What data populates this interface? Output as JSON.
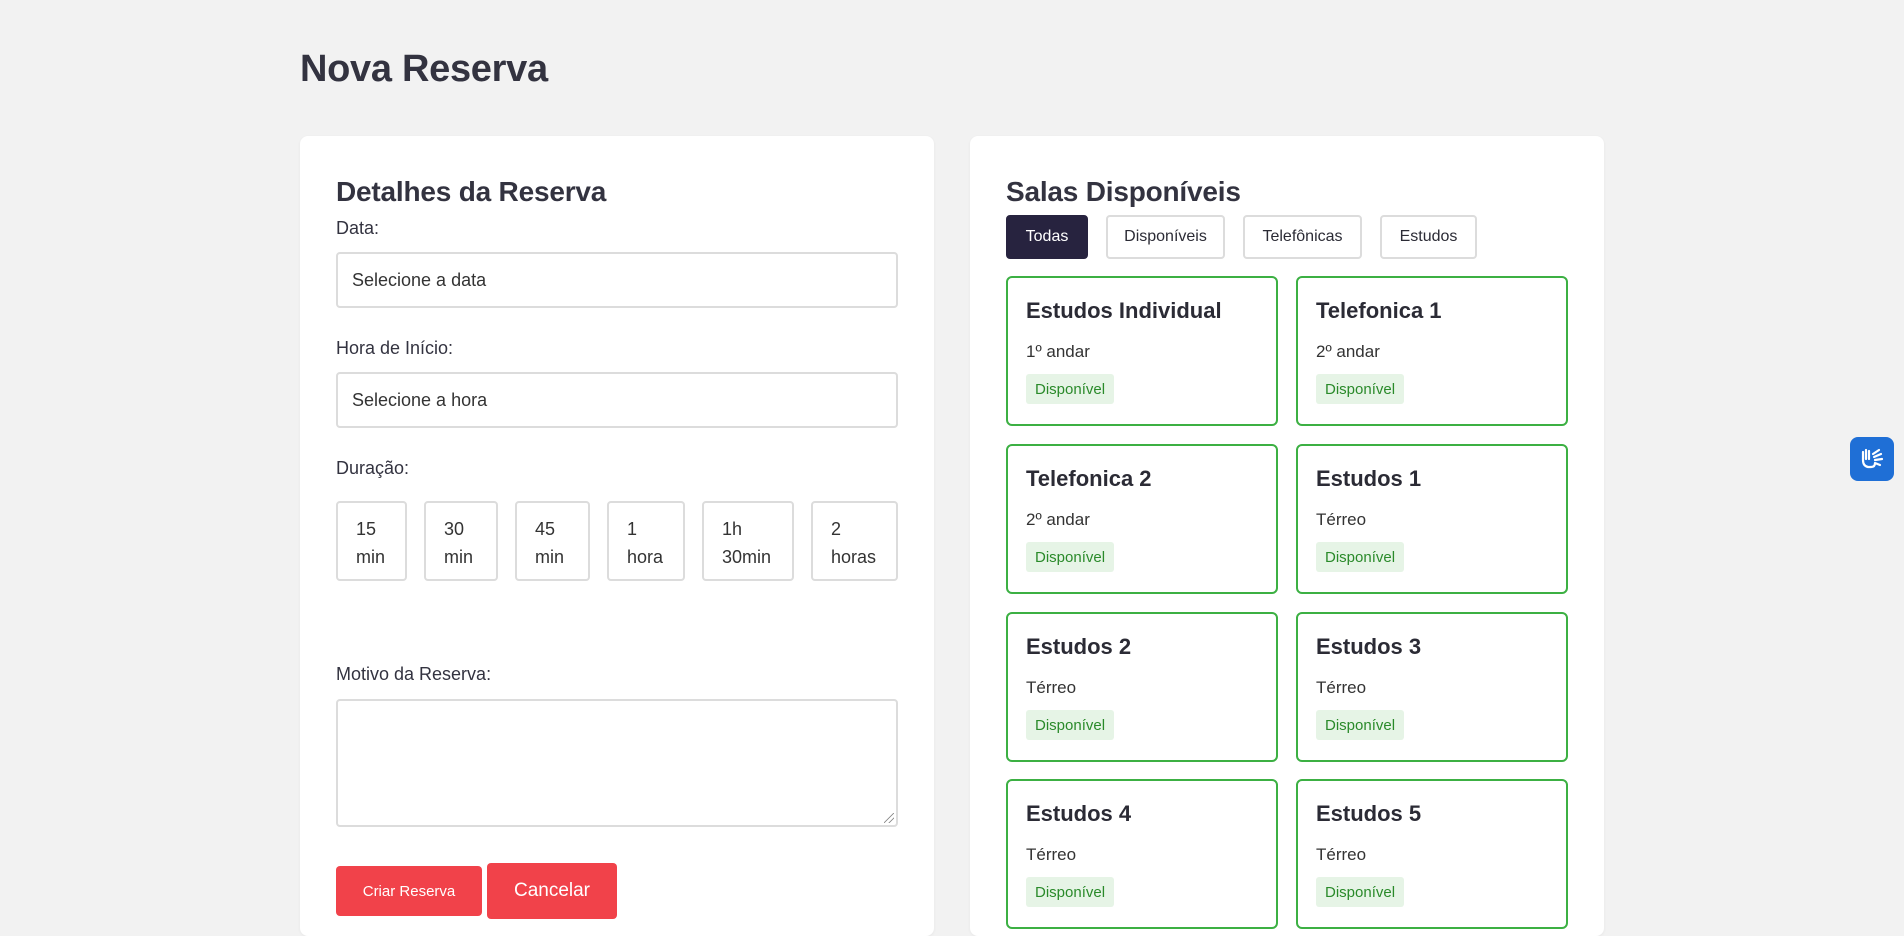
{
  "page": {
    "title": "Nova Reserva"
  },
  "details": {
    "title": "Detalhes da Reserva",
    "date_label": "Data:",
    "date_value": "Selecione a data",
    "time_label": "Hora de Início:",
    "time_value": "Selecione a hora",
    "duration_label": "Duração:",
    "durations": [
      "15 min",
      "30 min",
      "45 min",
      "1 hora",
      "1h 30min",
      "2 horas"
    ],
    "reason_label": "Motivo da Reserva:",
    "reason_value": "",
    "create_label": "Criar Reserva",
    "cancel_label": "Cancelar"
  },
  "rooms": {
    "title": "Salas Disponíveis",
    "filters": [
      "Todas",
      "Disponíveis",
      "Telefônicas",
      "Estudos"
    ],
    "active_filter": "Todas",
    "items": [
      {
        "name": "Estudos Individual",
        "floor": "1º andar",
        "status": "Disponível"
      },
      {
        "name": "Telefonica 1",
        "floor": "2º andar",
        "status": "Disponível"
      },
      {
        "name": "Telefonica 2",
        "floor": "2º andar",
        "status": "Disponível"
      },
      {
        "name": "Estudos 1",
        "floor": "Térreo",
        "status": "Disponível"
      },
      {
        "name": "Estudos 2",
        "floor": "Térreo",
        "status": "Disponível"
      },
      {
        "name": "Estudos 3",
        "floor": "Térreo",
        "status": "Disponível"
      },
      {
        "name": "Estudos 4",
        "floor": "Térreo",
        "status": "Disponível"
      },
      {
        "name": "Estudos 5",
        "floor": "Térreo",
        "status": "Disponível"
      }
    ]
  },
  "colors": {
    "accent_dark": "#27233f",
    "danger": "#f1424a",
    "available_border": "#3cb043",
    "available_badge_bg": "#e6f4e6",
    "available_badge_text": "#2a8a2a",
    "accessibility_blue": "#1f6fd6"
  },
  "icons": {
    "accessibility": "sign-language-hands-icon"
  }
}
